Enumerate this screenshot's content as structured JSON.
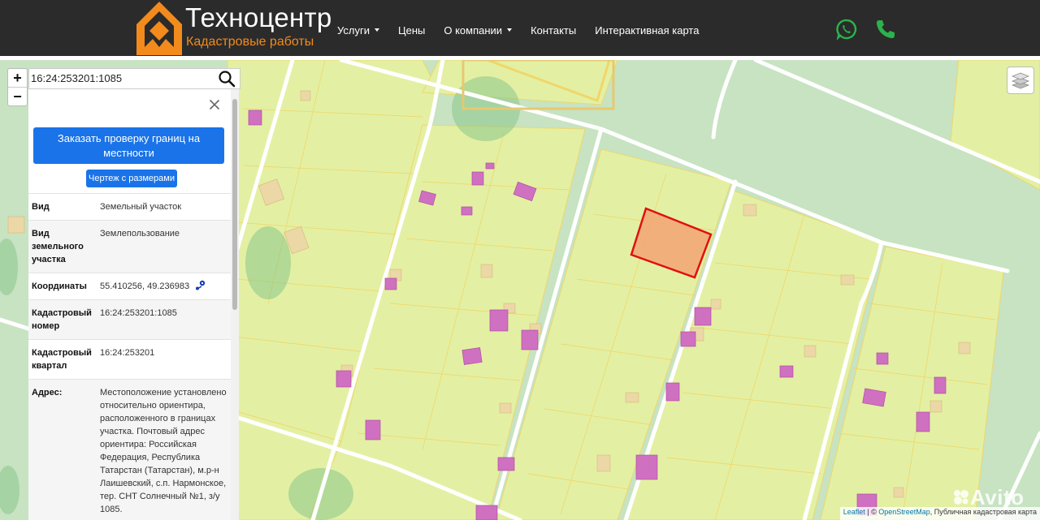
{
  "brand": {
    "title": "Техноцентр",
    "subtitle": "Кадастровые работы",
    "accent": "#f28a1c"
  },
  "nav": {
    "items": [
      {
        "label": "Услуги",
        "dropdown": true
      },
      {
        "label": "Цены",
        "dropdown": false
      },
      {
        "label": "О компании",
        "dropdown": true
      },
      {
        "label": "Контакты",
        "dropdown": false
      },
      {
        "label": "Интерактивная карта",
        "dropdown": false
      }
    ],
    "whatsapp_icon": "whatsapp-icon",
    "phone_icon": "phone-icon",
    "icon_color": "#2bb24c"
  },
  "search": {
    "value": "16:24:253201:1085"
  },
  "zoom": {
    "in_label": "+",
    "out_label": "−"
  },
  "panel": {
    "order_button": "Заказать проверку границ на местности",
    "drawing_button": "Чертеж с размерами",
    "rows": [
      {
        "key": "Вид",
        "value": "Земельный участок"
      },
      {
        "key": "Вид земельного участка",
        "value": "Землепользование"
      },
      {
        "key": "Координаты",
        "value": "55.410256, 49.236983"
      },
      {
        "key": "Кадастровый номер",
        "value": "16:24:253201:1085"
      },
      {
        "key": "Кадастровый квартал",
        "value": "16:24:253201"
      },
      {
        "key": "Адрес:",
        "value": "Местоположение установлено относительно ориентира, расположенного в границах участка. Почтовый адрес ориентира: Российская Федерация, Республика Татарстан (Татарстан), м.р-н Лаишевский, с.п. Нармонское, тер. СНТ Солнечный №1, з/у 1085."
      }
    ]
  },
  "attribution": {
    "leaflet": "Leaflet",
    "sep1": " | © ",
    "osm": "OpenStreetMap",
    "rest": ", Публичная кадастровая карта"
  },
  "watermark": "Avito",
  "colors": {
    "plot_fill": "#e3f0a3",
    "building": "#d070c0",
    "selected_outline": "#e01010",
    "selected_fill": "#f4a070",
    "button": "#1a73e8"
  }
}
